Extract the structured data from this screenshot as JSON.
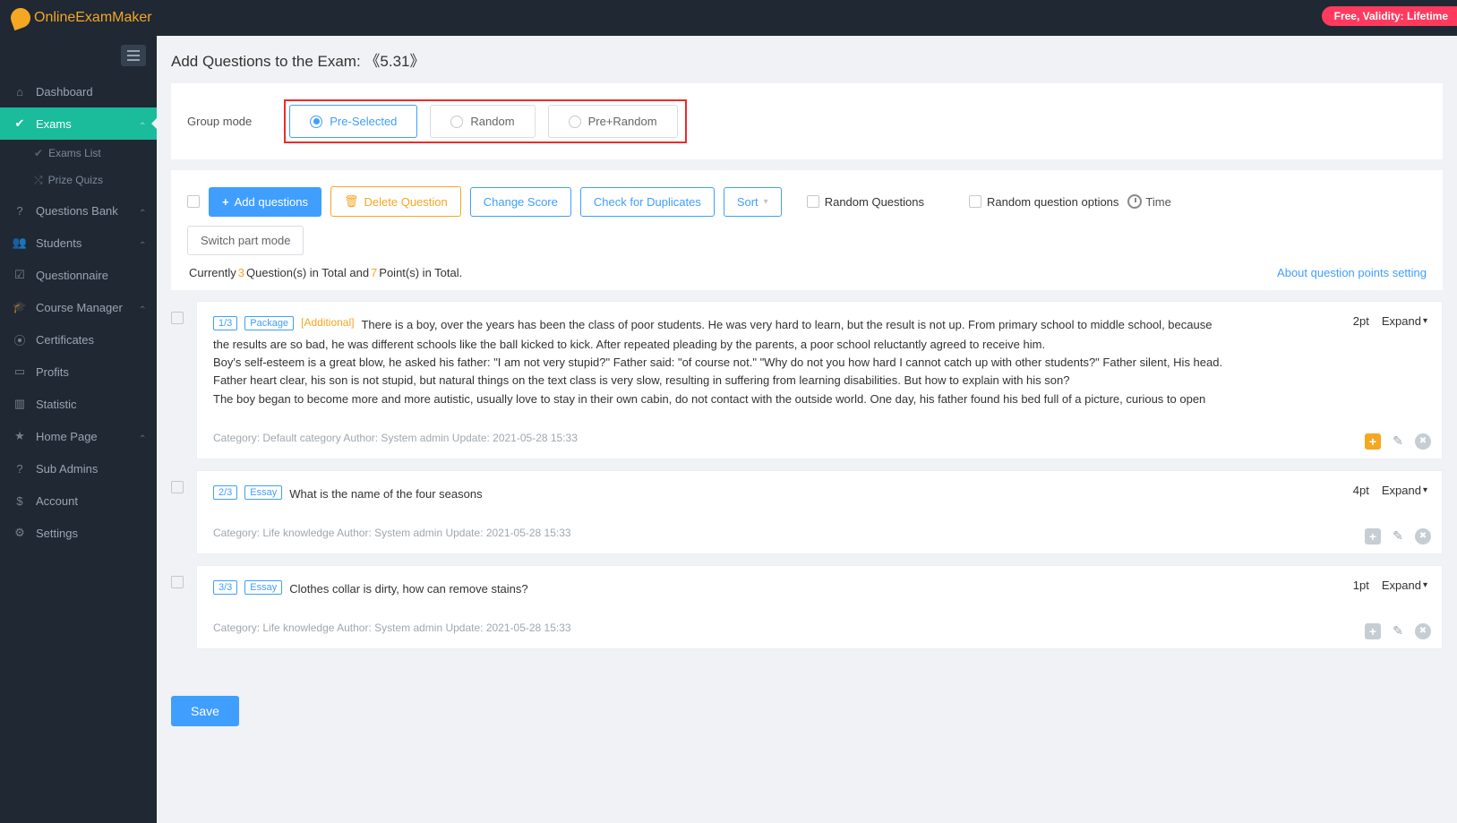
{
  "brand": "OnlineExamMaker",
  "promo": "Free, Validity: Lifetime",
  "sidebar": {
    "items": [
      {
        "label": "Dashboard",
        "icon": "home"
      },
      {
        "label": "Exams",
        "icon": "check-circle",
        "active": true,
        "children": [
          {
            "label": "Exams List"
          },
          {
            "label": "Prize Quizs"
          }
        ]
      },
      {
        "label": "Questions Bank",
        "icon": "help-circle"
      },
      {
        "label": "Students",
        "icon": "users"
      },
      {
        "label": "Questionnaire",
        "icon": "check-square"
      },
      {
        "label": "Course Manager",
        "icon": "graduation"
      },
      {
        "label": "Certificates",
        "icon": "seal"
      },
      {
        "label": "Profits",
        "icon": "card"
      },
      {
        "label": "Statistic",
        "icon": "bar"
      },
      {
        "label": "Home Page",
        "icon": "star"
      },
      {
        "label": "Sub Admins",
        "icon": "help-circle"
      },
      {
        "label": "Account",
        "icon": "dollar"
      },
      {
        "label": "Settings",
        "icon": "gear"
      }
    ]
  },
  "page": {
    "title_prefix": "Add Questions to the Exam: ",
    "exam_name": "《5.31》"
  },
  "group_mode": {
    "label": "Group mode",
    "options": [
      "Pre-Selected",
      "Random",
      "Pre+Random"
    ],
    "selected": 0
  },
  "toolbar": {
    "add": "Add questions",
    "delete": "Delete Question",
    "change_score": "Change Score",
    "dup": "Check for Duplicates",
    "sort": "Sort",
    "random_q": "Random Questions",
    "random_opt": "Random question options",
    "time": "Time",
    "switch_part": "Switch part mode"
  },
  "summary": {
    "currently": "Currently",
    "total_q": "3",
    "mid1": "Question(s) in Total and",
    "total_p": "7",
    "mid2": "Point(s) in Total.",
    "link": "About question points setting"
  },
  "questions": [
    {
      "idx": "1/3",
      "type": "Package",
      "additional": "[Additional]",
      "head_inline": "There is a boy, over the years has been the class of poor students. He was very hard to learn, but the result is not up. From primary school to middle school, because",
      "body": "the results are so bad, he was different schools like the ball kicked to kick. After repeated pleading by the parents, a poor school reluctantly agreed to receive him.\nBoy's self-esteem is a great blow, he asked his father: \"I am not very stupid?\" Father said: \"of course not.\" \"Why do not you how hard I cannot catch up with other students?\" Father silent, His head.\nFather heart clear, his son is not stupid, but natural things on the text class is very slow, resulting in suffering from learning disabilities. But how to explain with his son?\nThe boy began to become more and more autistic, usually love to stay in their own cabin, do not contact with the outside world. One day, his father found his bed full of a picture, curious to open",
      "meta": "Category: Default category   Author: System admin   Update: 2021-05-28 15:33",
      "points": "2pt",
      "expand": "Expand",
      "plus_highlight": true
    },
    {
      "idx": "2/3",
      "type": "Essay",
      "head_inline": "What is the name of the four seasons",
      "meta": "Category: Life knowledge   Author: System admin   Update: 2021-05-28 15:33",
      "points": "4pt",
      "expand": "Expand"
    },
    {
      "idx": "3/3",
      "type": "Essay",
      "head_inline": "Clothes collar is dirty, how can remove stains?",
      "meta": "Category: Life knowledge   Author: System admin   Update: 2021-05-28 15:33",
      "points": "1pt",
      "expand": "Expand"
    }
  ],
  "save": "Save"
}
